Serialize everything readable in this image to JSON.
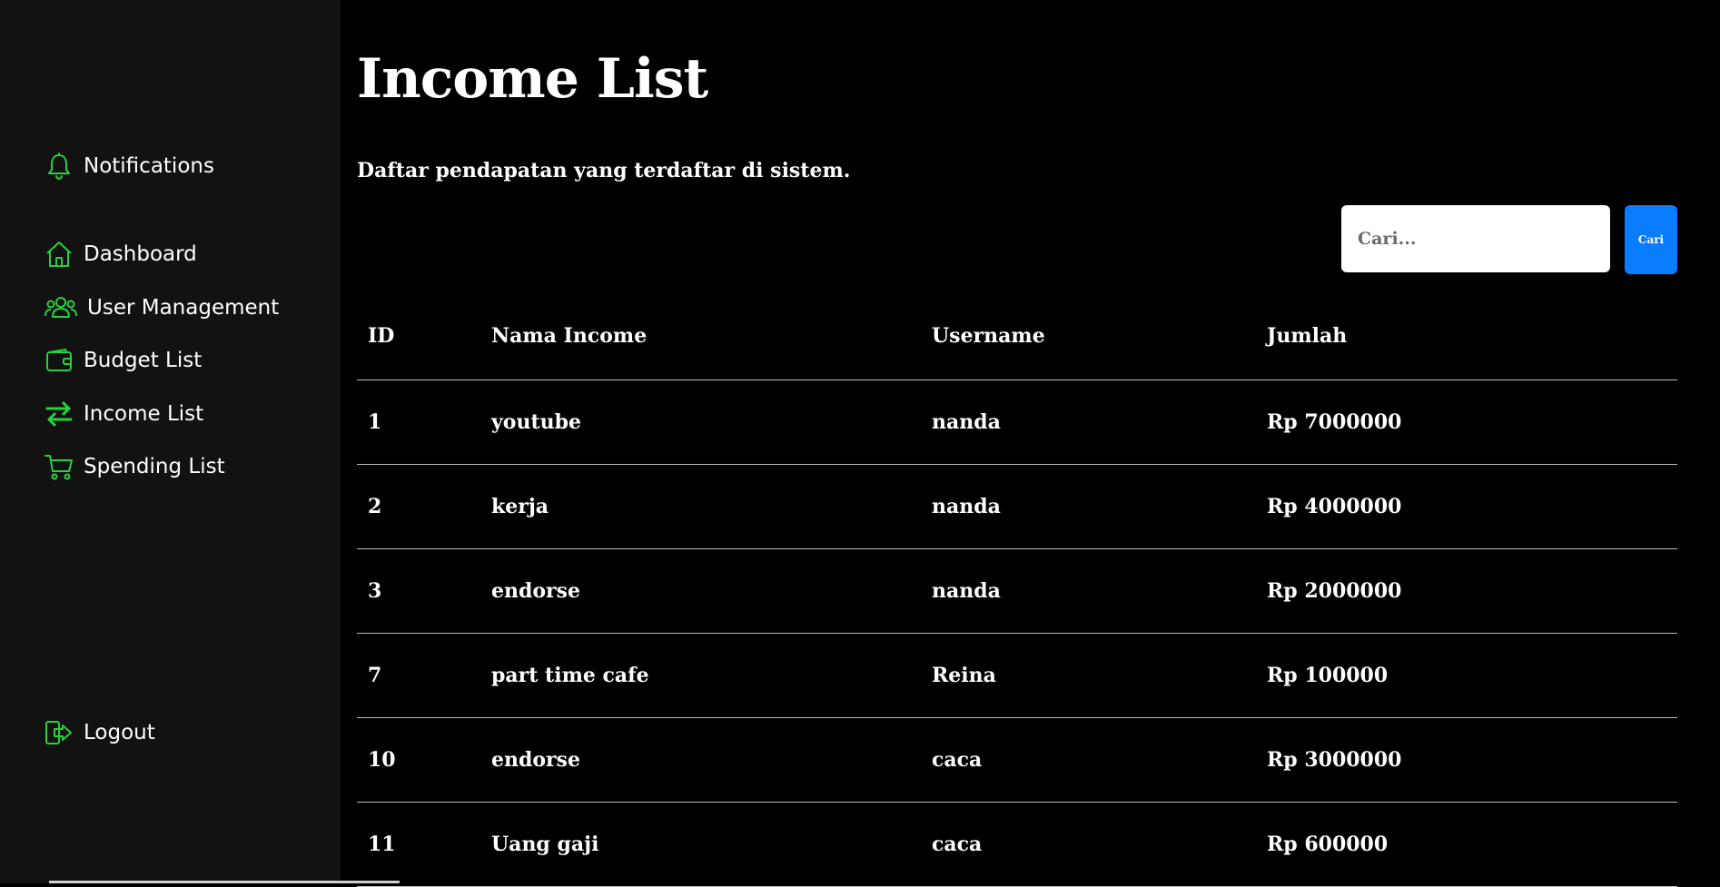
{
  "colors": {
    "sidebar_bg": "#121212",
    "main_bg": "#000000",
    "icon_accent": "#27d13b",
    "button_accent": "#0a7cff",
    "text": "#ffffff"
  },
  "sidebar": {
    "notifications": {
      "label": "Notifications",
      "icon": "bell-icon"
    },
    "items": [
      {
        "label": "Dashboard",
        "icon": "home-icon"
      },
      {
        "label": "User Management",
        "icon": "users-icon"
      },
      {
        "label": "Budget List",
        "icon": "wallet-icon"
      },
      {
        "label": "Income List",
        "icon": "arrows-swap-icon"
      },
      {
        "label": "Spending List",
        "icon": "cart-icon"
      }
    ],
    "logout": {
      "label": "Logout",
      "icon": "logout-icon"
    }
  },
  "main": {
    "title": "Income List",
    "subtitle": "Daftar pendapatan yang terdaftar di sistem.",
    "search": {
      "placeholder": "Cari...",
      "value": "",
      "button_label": "Cari"
    },
    "table": {
      "headers": [
        "ID",
        "Nama Income",
        "Username",
        "Jumlah"
      ],
      "rows": [
        [
          "1",
          "youtube",
          "nanda",
          "Rp 7000000"
        ],
        [
          "2",
          "kerja",
          "nanda",
          "Rp 4000000"
        ],
        [
          "3",
          "endorse",
          "nanda",
          "Rp 2000000"
        ],
        [
          "7",
          "part time cafe",
          "Reina",
          "Rp 100000"
        ],
        [
          "10",
          "endorse",
          "caca",
          "Rp 3000000"
        ],
        [
          "11",
          "Uang gaji",
          "caca",
          "Rp 600000"
        ]
      ]
    }
  }
}
